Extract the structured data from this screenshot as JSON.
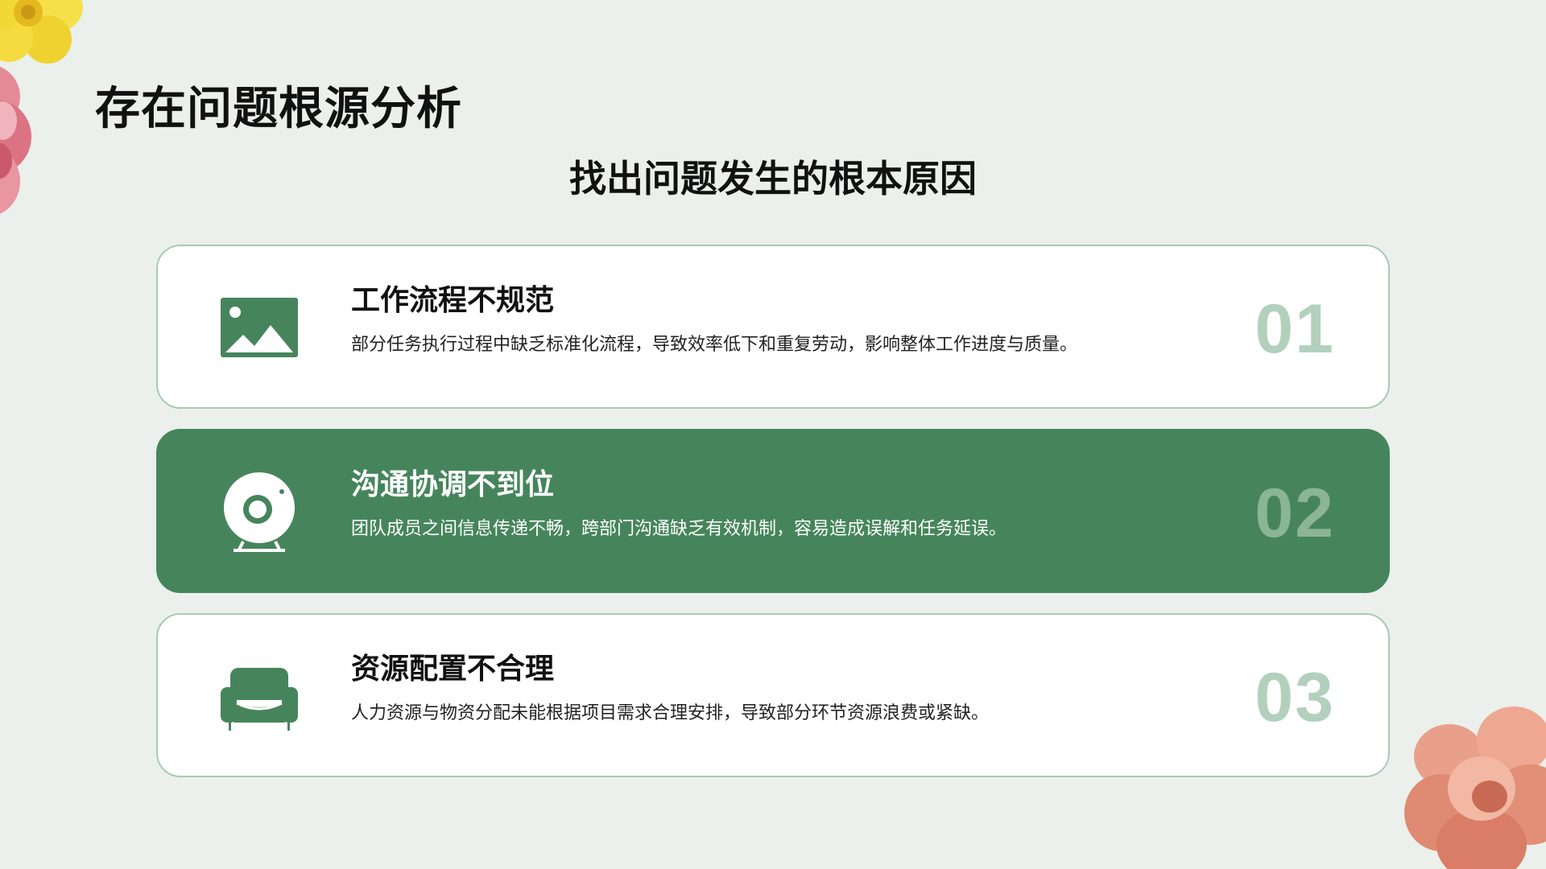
{
  "slide": {
    "title": "存在问题根源分析",
    "subtitle": "找出问题发生的根本原因"
  },
  "items": [
    {
      "heading": "工作流程不规范",
      "description": "部分任务执行过程中缺乏标准化流程，导致效率低下和重复劳动，影响整体工作进度与质量。",
      "number": "01",
      "icon": "image-icon"
    },
    {
      "heading": "沟通协调不到位",
      "description": "团队成员之间信息传递不畅，跨部门沟通缺乏有效机制，容易造成误解和任务延误。",
      "number": "02",
      "icon": "webcam-icon"
    },
    {
      "heading": "资源配置不合理",
      "description": "人力资源与物资分配未能根据项目需求合理安排，导致部分环节资源浪费或紧缺。",
      "number": "03",
      "icon": "sofa-icon"
    }
  ],
  "colors": {
    "background": "#ebf0ec",
    "accent_green": "#46855c",
    "number_light": "#b3d0bd",
    "card_border": "#a9cab3"
  }
}
